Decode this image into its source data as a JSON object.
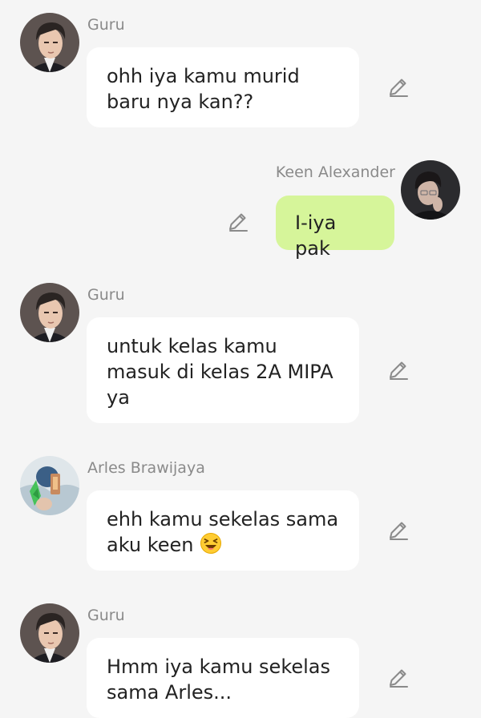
{
  "messages": [
    {
      "sender": "Guru",
      "text": "ohh iya kamu murid baru nya kan??",
      "avatar": "guru-avatar"
    },
    {
      "sender": "Keen Alexander",
      "text": "I-iya pak",
      "avatar": "keen-avatar"
    },
    {
      "sender": "Guru",
      "text": "untuk kelas kamu masuk di kelas 2A MIPA ya",
      "avatar": "guru-avatar"
    },
    {
      "sender": "Arles Brawijaya",
      "text": "ehh kamu sekelas sama aku keen",
      "emoji": "laughing-squint-emoji",
      "avatar": "arles-avatar"
    },
    {
      "sender": "Guru",
      "text": "Hmm iya kamu sekelas sama Arles...",
      "avatar": "guru-avatar"
    }
  ],
  "colors": {
    "background": "#f5f5f5",
    "bubble_other": "#ffffff",
    "bubble_self": "#d6f59a",
    "sender_name": "#8a8a8a",
    "icon": "#8a8a8a"
  }
}
